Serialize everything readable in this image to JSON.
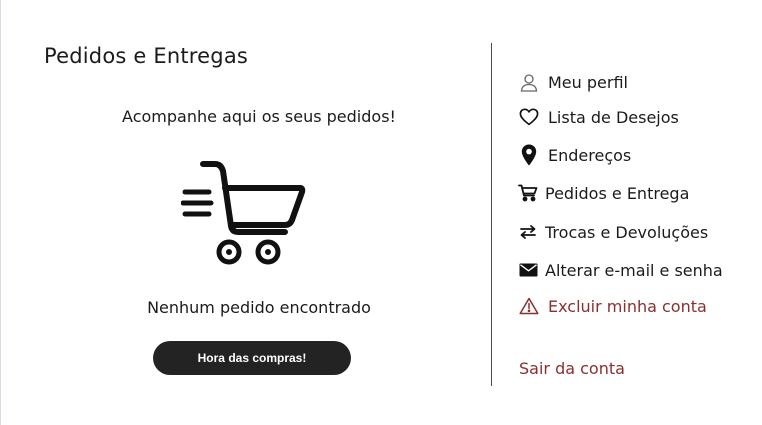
{
  "page": {
    "title": "Pedidos e Entregas",
    "subtitle": "Acompanhe aqui os seus pedidos!",
    "empty_message": "Nenhum pedido encontrado",
    "shop_button_label": "Hora das compras!"
  },
  "sidebar": {
    "items": [
      {
        "label": "Meu perfil",
        "icon": "user-icon"
      },
      {
        "label": "Lista de Desejos",
        "icon": "heart-icon"
      },
      {
        "label": "Endereços",
        "icon": "location-pin-icon"
      },
      {
        "label": "Pedidos e Entrega",
        "icon": "cart-icon"
      },
      {
        "label": "Trocas e Devoluções",
        "icon": "exchange-arrows-icon"
      },
      {
        "label": "Alterar e-mail e senha",
        "icon": "envelope-icon"
      },
      {
        "label": "Excluir minha conta",
        "icon": "warning-icon"
      }
    ],
    "logout_label": "Sair da conta"
  },
  "colors": {
    "button_bg": "#232323",
    "danger": "#8a2f2f",
    "text": "#1b1b1b"
  }
}
